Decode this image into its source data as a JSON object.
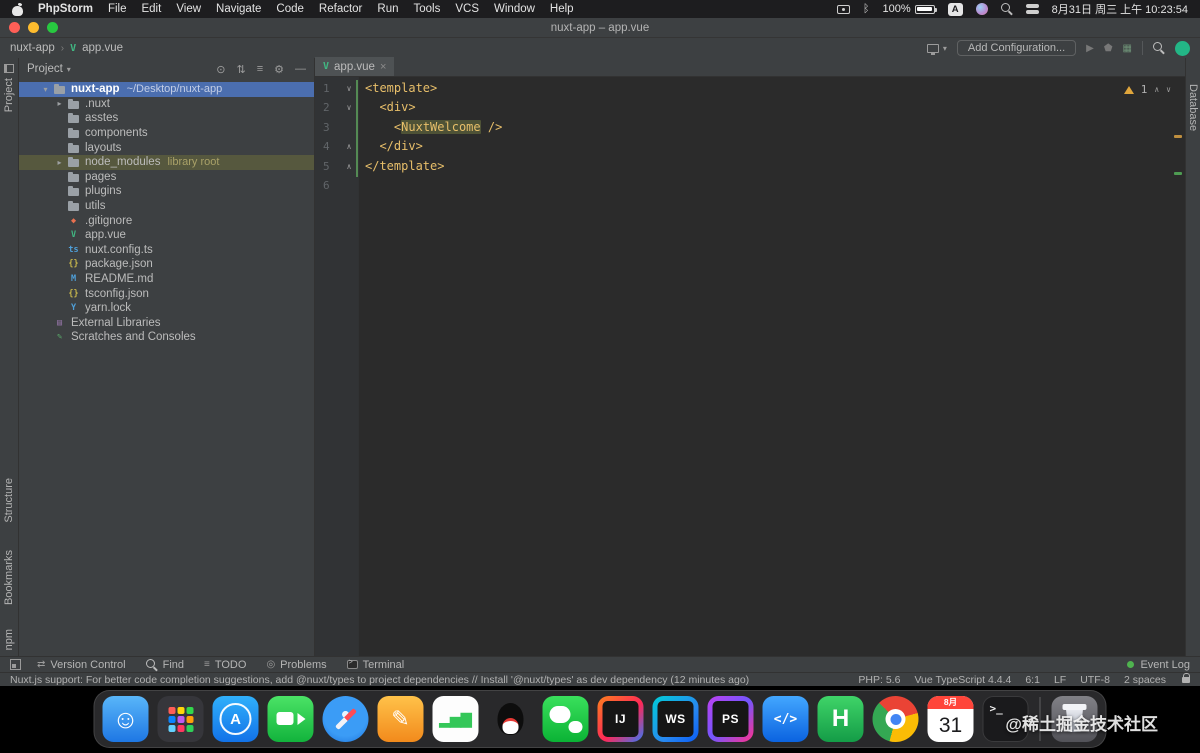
{
  "menubar": {
    "app_name": "PhpStorm",
    "items": [
      "File",
      "Edit",
      "View",
      "Navigate",
      "Code",
      "Refactor",
      "Run",
      "Tools",
      "VCS",
      "Window",
      "Help"
    ],
    "battery": "100%",
    "input_label": "A",
    "clock": "8月31日 周三 上午 10:23:54"
  },
  "titlebar": {
    "title": "nuxt-app – app.vue"
  },
  "toolbar": {
    "breadcrumb_project": "nuxt-app",
    "breadcrumb_separator": "›",
    "breadcrumb_file_icon": "V",
    "breadcrumb_file": "app.vue",
    "add_configuration": "Add Configuration..."
  },
  "left_strip": {
    "top_label": "Project",
    "bottom_labels": [
      "Structure",
      "Bookmarks"
    ],
    "corner_label": "npm"
  },
  "right_strip": {
    "top_label": "Database"
  },
  "project_panel": {
    "title": "Project",
    "tree": [
      {
        "label": "nuxt-app",
        "hint": "~/Desktop/nuxt-app",
        "icon": "folder",
        "indent": 1,
        "arrow": "▾",
        "selected": true,
        "bold": true
      },
      {
        "label": ".nuxt",
        "icon": "folder",
        "indent": 2,
        "arrow": "▸"
      },
      {
        "label": "asstes",
        "icon": "folder",
        "indent": 2
      },
      {
        "label": "components",
        "icon": "folder",
        "indent": 2
      },
      {
        "label": "layouts",
        "icon": "folder",
        "indent": 2
      },
      {
        "label": "node_modules",
        "hint": "library root",
        "icon": "folder",
        "indent": 2,
        "arrow": "▸",
        "library": true
      },
      {
        "label": "pages",
        "icon": "folder",
        "indent": 2
      },
      {
        "label": "plugins",
        "icon": "folder",
        "indent": 2
      },
      {
        "label": "utils",
        "icon": "folder",
        "indent": 2
      },
      {
        "label": ".gitignore",
        "icon": "git",
        "indent": 2
      },
      {
        "label": "app.vue",
        "icon": "vue",
        "indent": 2
      },
      {
        "label": "nuxt.config.ts",
        "icon": "ts",
        "indent": 2
      },
      {
        "label": "package.json",
        "icon": "json",
        "indent": 2
      },
      {
        "label": "README.md",
        "icon": "md",
        "indent": 2
      },
      {
        "label": "tsconfig.json",
        "icon": "json",
        "indent": 2
      },
      {
        "label": "yarn.lock",
        "icon": "yarn",
        "indent": 2
      },
      {
        "label": "External Libraries",
        "icon": "lib",
        "indent": 1
      },
      {
        "label": "Scratches and Consoles",
        "icon": "scratch",
        "indent": 1
      }
    ]
  },
  "editor": {
    "tab": "app.vue",
    "inspection_count": "1",
    "lines": [
      {
        "num": "1",
        "fold": "v",
        "segs": [
          {
            "t": "<template>",
            "c": "tag"
          }
        ]
      },
      {
        "num": "2",
        "fold": "v",
        "segs": [
          {
            "t": "  ",
            "c": "p"
          },
          {
            "t": "<div>",
            "c": "tag"
          }
        ]
      },
      {
        "num": "3",
        "segs": [
          {
            "t": "    ",
            "c": "p"
          },
          {
            "t": "<",
            "c": "tag"
          },
          {
            "t": "NuxtWelcome",
            "c": "tag hl"
          },
          {
            "t": " />",
            "c": "tag"
          }
        ]
      },
      {
        "num": "4",
        "fold": "^",
        "segs": [
          {
            "t": "  ",
            "c": "p"
          },
          {
            "t": "</div>",
            "c": "tag"
          }
        ]
      },
      {
        "num": "5",
        "fold": "^",
        "segs": [
          {
            "t": "</template>",
            "c": "tag"
          }
        ]
      },
      {
        "num": "6",
        "segs": []
      }
    ]
  },
  "bottom_bar": {
    "items": [
      {
        "label": "Version Control",
        "icon": "vcs"
      },
      {
        "label": "Find",
        "icon": "find"
      },
      {
        "label": "TODO",
        "icon": "todo"
      },
      {
        "label": "Problems",
        "icon": "problems"
      },
      {
        "label": "Terminal",
        "icon": "terminal"
      }
    ],
    "event_log": "Event Log"
  },
  "status_bar": {
    "message": "Nuxt.js support: For better code completion suggestions, add @nuxt/types to project dependencies // Install '@nuxt/types' as dev dependency (12 minutes ago)",
    "items": [
      "PHP: 5.6",
      "Vue TypeScript 4.4.4",
      "6:1",
      "LF",
      "UTF-8",
      "2 spaces"
    ]
  },
  "dock": {
    "apps": [
      {
        "name": "finder"
      },
      {
        "name": "launchpad"
      },
      {
        "name": "app-store"
      },
      {
        "name": "facetime"
      },
      {
        "name": "safari"
      },
      {
        "name": "pen-app"
      },
      {
        "name": "stats-app"
      },
      {
        "name": "qq"
      },
      {
        "name": "wechat"
      },
      {
        "name": "intellij-idea"
      },
      {
        "name": "webstorm"
      },
      {
        "name": "phpstorm"
      },
      {
        "name": "dev-app"
      },
      {
        "name": "hbuilderx"
      },
      {
        "name": "chrome"
      },
      {
        "name": "calendar",
        "top": "8月",
        "day": "31"
      },
      {
        "name": "terminal"
      },
      {
        "name": "trash"
      }
    ]
  },
  "watermark": "@稀土掘金技术社区",
  "colors": {
    "selection_blue": "#4b6eaf",
    "library_row": "#56583e",
    "tag_yellow": "#e8bf6a",
    "editor_bg": "#2b2b2b",
    "panel_bg": "#3d4042"
  }
}
